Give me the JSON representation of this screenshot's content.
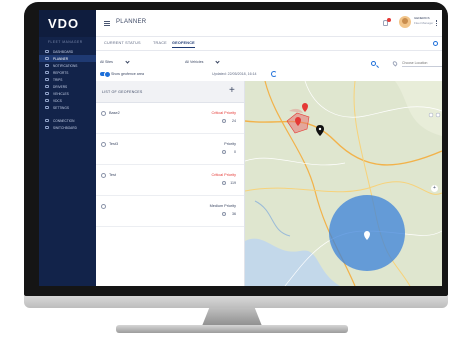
{
  "app": {
    "logo": "VDO",
    "product": "FLEET MANAGER",
    "page_title": "PLANNER"
  },
  "sidebar": {
    "items": [
      {
        "label": "DASHBOARD",
        "icon": "dashboard-icon",
        "active": false
      },
      {
        "label": "PLANNER",
        "icon": "planner-icon",
        "active": true
      },
      {
        "label": "NOTIFICATIONS",
        "icon": "bell-icon",
        "active": false
      },
      {
        "label": "REPORTS",
        "icon": "report-icon",
        "active": false
      },
      {
        "label": "TRIPS",
        "icon": "route-icon",
        "active": false
      },
      {
        "label": "DRIVERS",
        "icon": "driver-icon",
        "active": false
      },
      {
        "label": "VEHICLES",
        "icon": "truck-icon",
        "active": false
      },
      {
        "label": "VDCS",
        "icon": "card-icon",
        "active": false
      },
      {
        "label": "SETTINGS",
        "icon": "gear-icon",
        "active": false
      }
    ],
    "bottom_items": [
      {
        "label": "CONNECTION",
        "icon": "connection-icon"
      },
      {
        "label": "SWITCHBOARD",
        "icon": "switchboard-icon"
      }
    ]
  },
  "user": {
    "name": "GENERICS",
    "role": "Fleet Manager"
  },
  "tabs": [
    {
      "label": "CURRENT STATUS",
      "active": false
    },
    {
      "label": "TRACE",
      "active": false
    },
    {
      "label": "GEOFENCE",
      "active": true
    }
  ],
  "filters": {
    "sites": "All Sites",
    "vehicles": "All Vehicles",
    "location_placeholder": "Choose Location",
    "toggle_label": "Show geofence area",
    "updated": "Updated: 22/05/2018, 16:14"
  },
  "geofence_list": {
    "title": "LIST OF GEOFENCES",
    "add_label": "+",
    "rows": [
      {
        "name": "Base2",
        "priority": "Critical Priority",
        "priority_color": "#e53935",
        "count": "24"
      },
      {
        "name": "Test3",
        "priority": "Priority",
        "priority_color": "#3b4763",
        "count": "0"
      },
      {
        "name": "Test",
        "priority": "Critical Priority",
        "priority_color": "#e53935",
        "count": "119"
      },
      {
        "name": "",
        "priority": "Medium Priority",
        "priority_color": "#3b4763",
        "count": "36"
      }
    ]
  },
  "map": {
    "zoom_in": "+",
    "circle_color": "#3b82d9",
    "polygon_color": "#e57373"
  },
  "colors": {
    "sidebar": "#12234a",
    "accent": "#1e6fd9",
    "critical": "#e53935"
  }
}
